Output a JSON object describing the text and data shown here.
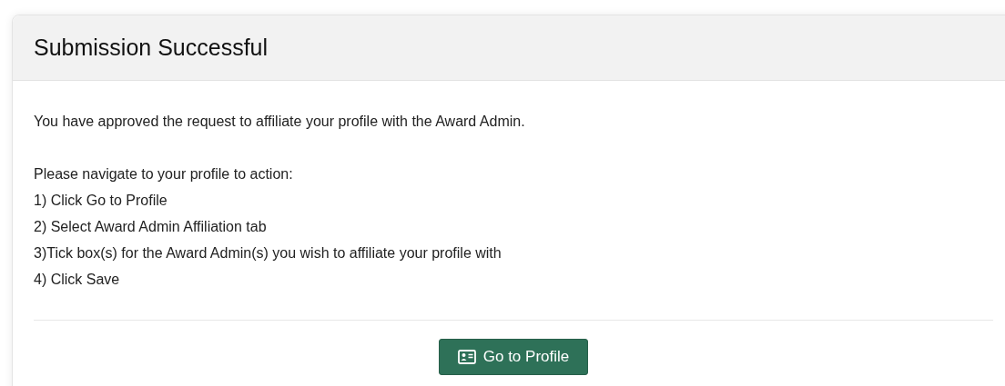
{
  "card": {
    "title": "Submission Successful",
    "message": "You have approved the request to affiliate your profile with the Award Admin.",
    "intro": "Please navigate to your profile to action:",
    "steps": [
      "1) Click Go to Profile",
      "2) Select Award Admin Affiliation tab",
      "3)Tick box(s) for the Award Admin(s) you wish to affiliate your profile with",
      "4) Click Save"
    ],
    "button": "Go to Profile"
  }
}
